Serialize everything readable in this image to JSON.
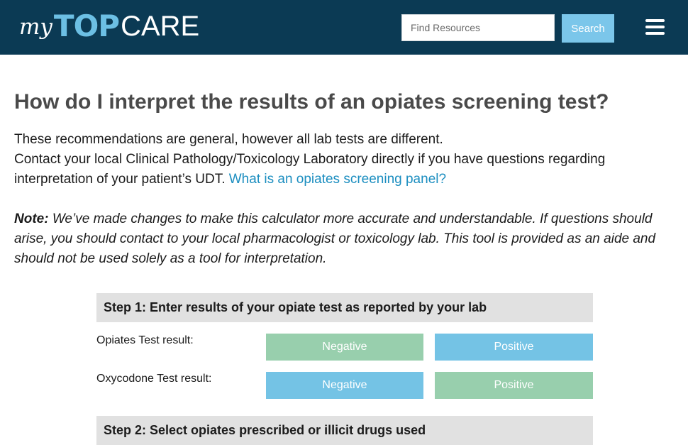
{
  "header": {
    "logo": {
      "my": "my",
      "top": "TOP",
      "care": "CARE"
    },
    "search": {
      "placeholder": "Find Resources",
      "value": "",
      "button_label": "Search"
    },
    "menu_icon": "hamburger-menu-icon"
  },
  "main": {
    "title": "How do I interpret the results of an opiates screening test?",
    "intro_line1": "These recommendations are general, however all lab tests are different.",
    "intro_line2": "Contact your local Clinical Pathology/Toxicology Laboratory directly if you have questions regarding interpretation of your patient’s UDT.",
    "intro_link": "What is an opiates screening panel?",
    "note_label": "Note:",
    "note_text": "We’ve made changes to make this calculator more accurate and understandable. If questions should arise, you should contact to your local pharmacologist or toxicology lab. This tool is provided as an aide and should not be used solely as a tool for interpretation."
  },
  "calculator": {
    "step1": {
      "title": "Step 1: Enter results of your opiate test as reported by your lab",
      "rows": [
        {
          "label": "Opiates Test result:",
          "negative": "Negative",
          "positive": "Positive",
          "selected": "Negative"
        },
        {
          "label": "Oxycodone Test result:",
          "negative": "Negative",
          "positive": "Positive",
          "selected": "Positive"
        }
      ]
    },
    "step2": {
      "title": "Step 2: Select opiates prescribed or illicit drugs used"
    }
  },
  "colors": {
    "header_bg": "#0b3a54",
    "logo_accent": "#6cbfe4",
    "link": "#1c8ec0",
    "toggle_green": "#98cfad",
    "toggle_blue": "#74c3e5",
    "step_header_bg": "#e1e1e1"
  }
}
